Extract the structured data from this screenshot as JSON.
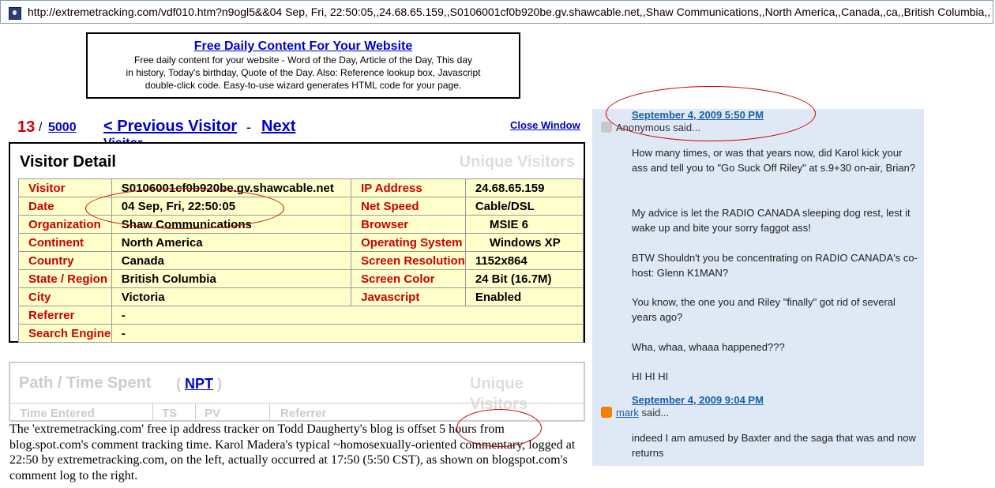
{
  "address_bar": {
    "url": "http://extremetracking.com/vdf010.htm?n9ogl5&&04 Sep, Fri, 22:50:05,,24.68.65.159,,S0106001cf0b920be.gv.shawcable.net,,Shaw Communications,,North America,,Canada,,ca,,British Columbia,,Victoria"
  },
  "ad": {
    "title": "Free Daily Content For Your Website",
    "lines": [
      "Free daily content for your website - Word of the Day, Article of the Day, This day",
      "in history, Today's birthday, Quote of the Day. Also: Reference lookup box, Javascript",
      "double-click code. Easy-to-use wizard generates HTML code for your page."
    ]
  },
  "counter": {
    "current": "13",
    "separator": "/",
    "total": "5000"
  },
  "nav": {
    "previous": "< Previous Visitor",
    "dash": "-",
    "next": "Next",
    "next_cut": "Visitor",
    "close": "Close Window"
  },
  "visitor_detail": {
    "title": "Visitor Detail",
    "watermark": "Unique Visitors",
    "rows": [
      {
        "k1": "Visitor",
        "v1": "S0106001cf0b920be.gv.shawcable.net",
        "k2": "IP Address",
        "v2": "24.68.65.159"
      },
      {
        "k1": "Date",
        "v1": "04 Sep, Fri, 22:50:05",
        "k2": "Net Speed",
        "v2": "Cable/DSL"
      },
      {
        "k1": "Organization",
        "v1": "Shaw Communications",
        "k2": "Browser",
        "v2": "MSIE 6"
      },
      {
        "k1": "Continent",
        "v1": "North America",
        "k2": "Operating System",
        "v2": "Windows XP"
      },
      {
        "k1": "Country",
        "v1": "Canada",
        "k2": "Screen Resolution",
        "v2": "1152x864"
      },
      {
        "k1": "State / Region",
        "v1": "British Columbia",
        "k2": "Screen Color",
        "v2": "24 Bit (16.7M)"
      },
      {
        "k1": "City",
        "v1": "Victoria",
        "k2": "Javascript",
        "v2": "Enabled"
      },
      {
        "k1": "Referrer",
        "v1": "-"
      },
      {
        "k1": "Search Engine",
        "v1": "-"
      }
    ]
  },
  "path": {
    "title": "Path / Time Spent",
    "npt_open": "(",
    "npt": "NPT",
    "npt_close": ")",
    "watermark": "Unique Visitors",
    "columns": [
      "Time Entered",
      "TS",
      "PV",
      "Referrer"
    ]
  },
  "caption": {
    "before": "The 'extremetracking.com' free ip address tracker on Todd Daugherty's blog is ",
    "highlight": "offset 5 hours",
    "after": " from blog.spot.com's comment tracking time. Karol Madera's typical  ~homosexually-oriented commentary,  logged at 22:50 by extremetracking.com, on the left, actually occurred at 17:50 (5:50 CST), as shown on blogspot.com's comment log to the right."
  },
  "comments": [
    {
      "date": "September 4, 2009 5:50 PM",
      "author": "Anonymous",
      "said": "said...",
      "paragraphs": [
        "How many times, or was that years now, did Karol kick your ass and tell you to \"Go Suck Off Riley\" at s.9+30 on-air, Brian?",
        "My advice is let the RADIO CANADA sleeping dog rest, lest it wake up and bite your sorry faggot ass!",
        "BTW Shouldn't you be concentrating on RADIO CANADA's co-host: Glenn K1MAN?",
        "You know, the one you and Riley \"finally\" got rid of several years ago?",
        "Wha, whaa, whaaa happened???",
        "HI HI HI"
      ]
    },
    {
      "date": "September 4, 2009 9:04 PM",
      "author": "mark",
      "said": "said...",
      "paragraphs": [
        "indeed I am amused by Baxter and the saga that was and now returns"
      ]
    }
  ],
  "colors": {
    "link": "#0000cc",
    "label_red": "#cc0000",
    "cell_bg": "#ffffcc",
    "panel_bg": "#dfe8f5",
    "annotation": "#cc0000"
  }
}
